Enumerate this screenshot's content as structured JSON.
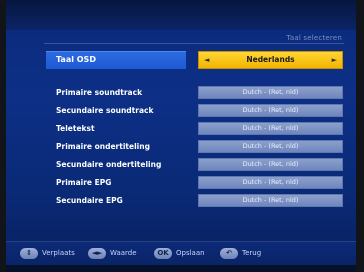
{
  "header": {
    "title": "Taal selecteren"
  },
  "osd": {
    "label": "Taal OSD",
    "value": "Nederlands",
    "left_arrow": "◄",
    "right_arrow": "►"
  },
  "settings": [
    {
      "label": "Primaire soundtrack",
      "value": "Dutch - (Ret, nld)"
    },
    {
      "label": "Secundaire soundtrack",
      "value": "Dutch - (Ret, nld)"
    },
    {
      "label": "Teletekst",
      "value": "Dutch - (Ret, nld)"
    },
    {
      "label": "Primaire ondertiteling",
      "value": "Dutch - (Ret, nld)"
    },
    {
      "label": "Secundaire ondertiteling",
      "value": "Dutch - (Ret, nld)"
    },
    {
      "label": "Primaire EPG",
      "value": "Dutch - (Ret, nld)"
    },
    {
      "label": "Secundaire EPG",
      "value": "Dutch - (Ret, nld)"
    }
  ],
  "footer": {
    "hints": [
      {
        "icon": "updown-icon",
        "icon_text": "⇕",
        "label": "Verplaats"
      },
      {
        "icon": "leftright-icon",
        "icon_text": "◄►",
        "label": "Waarde"
      },
      {
        "icon": "ok-icon",
        "icon_text": "OK",
        "label": "Opslaan"
      },
      {
        "icon": "back-icon",
        "icon_text": "↶",
        "label": "Terug"
      }
    ]
  },
  "colors": {
    "screen_blue": "#0d2f86",
    "highlight_blue": "#2b6be0",
    "select_yellow": "#f2b400",
    "value_box": "#7f93c6"
  }
}
